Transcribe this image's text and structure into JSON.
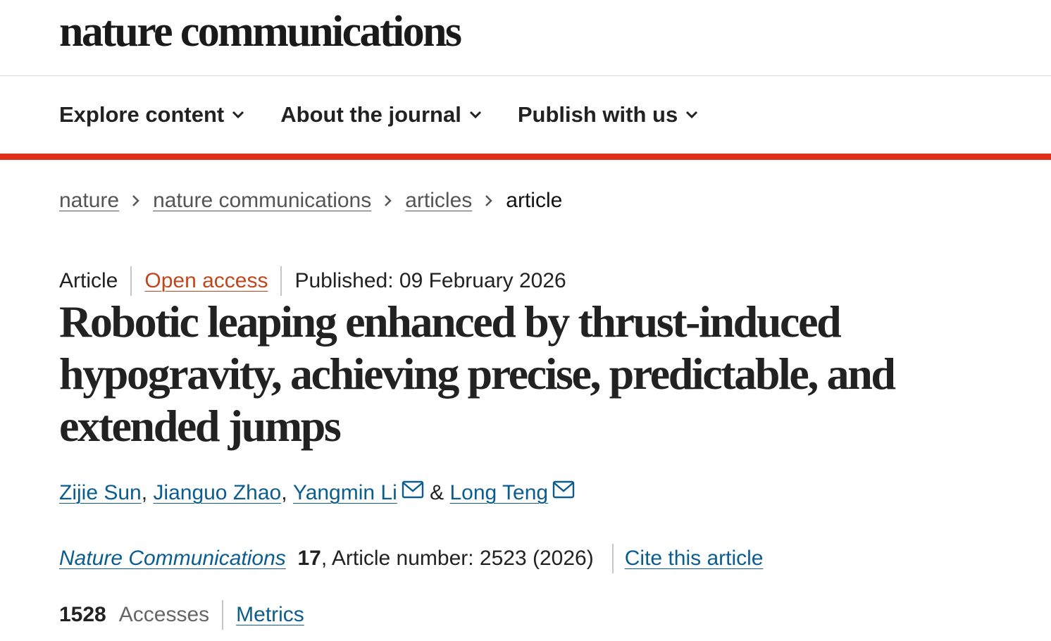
{
  "header": {
    "logo_text": "nature communications"
  },
  "nav": {
    "items": [
      {
        "label": "Explore content"
      },
      {
        "label": "About the journal"
      },
      {
        "label": "Publish with us"
      }
    ]
  },
  "colors": {
    "accent_bar": "#e0301e",
    "link": "#0b5d8f",
    "open_access": "#c0471d"
  },
  "breadcrumb": {
    "items": [
      {
        "label": "nature"
      },
      {
        "label": "nature communications"
      },
      {
        "label": "articles"
      }
    ],
    "current": "article"
  },
  "meta": {
    "type": "Article",
    "access": "Open access",
    "published": "Published: 09 February 2026"
  },
  "article": {
    "title": "Robotic leaping enhanced by thrust-induced hypogravity, achieving precise, predictable, and extended jumps"
  },
  "authors": {
    "list": [
      {
        "name": "Zijie Sun"
      },
      {
        "name": "Jianguo Zhao"
      },
      {
        "name": "Yangmin Li"
      },
      {
        "name": "Long Teng"
      }
    ],
    "comma": ",",
    "ampersand": "&"
  },
  "citation": {
    "journal": "Nature Communications",
    "volume": "17",
    "article_number": ", Article number: 2523 (2026)",
    "cite_label": "Cite this article"
  },
  "metrics": {
    "accesses": "1528",
    "accesses_label": "Accesses",
    "metrics_label": "Metrics"
  },
  "icons": {
    "nav_chevron": "chevron-down-icon",
    "breadcrumb_sep": "chevron-right-icon",
    "mail": "mail-icon"
  }
}
